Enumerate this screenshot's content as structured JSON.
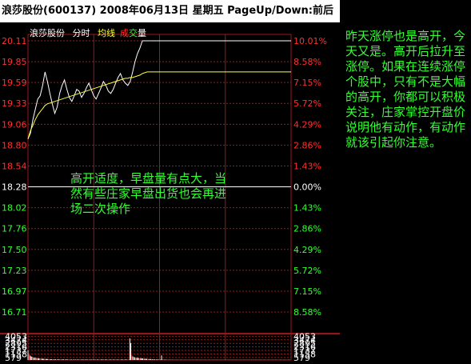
{
  "header": {
    "title": "浪莎股份(600137) 2008年06月13日 星期五 PageUp/Down:前后"
  },
  "legend": {
    "name": "浪莎股份",
    "tab_time": "分时",
    "tab_avg": "均线",
    "tab_cheng": "成",
    "tab_jiao": "交",
    "tab_liang": "量"
  },
  "colors": {
    "up": "#ff3030",
    "down": "#33ff33",
    "neutral": "#ffffff",
    "grid": "#a01818",
    "price_line": "#ffffff",
    "avg_line": "#ffff40",
    "legend_avg": "#ffff40",
    "legend_cheng": "#ff3030",
    "legend_jiao": "#33ff33"
  },
  "annotation": {
    "chart_note": "高开适度，早盘量有点大，当然有些庄家早盘出货也会再进场二次操作",
    "side_note": "昨天涨停也是高开，今天又是。高开后拉升至涨停。如果在连续涨停个股中，只有不是大幅的高开，你都可以积极关注，庄家掌控开盘价说明他有动作，有动作就该引起你注意。"
  },
  "chart_data": [
    {
      "type": "line",
      "title": "",
      "y_ticks": [
        "20.11",
        "19.85",
        "19.59",
        "19.33",
        "19.06",
        "18.80",
        "18.54",
        "18.28",
        "18.02",
        "17.76",
        "17.50",
        "17.23",
        "16.97",
        "16.71"
      ],
      "pct_ticks": [
        "10.01%",
        "8.58%",
        "7.15%",
        "5.72%",
        "4.29%",
        "2.86%",
        "1.43%",
        "0.00%",
        "1.43%",
        "2.86%",
        "4.29%",
        "5.72%",
        "7.15%",
        "8.58%"
      ],
      "prev_close": 18.28,
      "ylim": [
        16.45,
        20.11
      ],
      "x_count": 241,
      "series": [
        {
          "values": [
            18.88,
            18.95,
            19.12,
            19.25,
            19.38,
            19.42,
            19.55,
            19.72,
            19.6,
            19.45,
            19.32,
            19.2,
            19.28,
            19.45,
            19.55,
            19.62,
            19.5,
            19.4,
            19.35,
            19.42,
            19.5,
            19.48,
            19.4,
            19.45,
            19.52,
            19.58,
            19.5,
            19.42,
            19.38,
            19.45,
            19.52,
            19.6,
            19.55,
            19.48,
            19.45,
            19.5,
            19.58,
            19.65,
            19.7,
            19.62,
            19.58,
            19.55,
            19.6,
            19.72,
            19.85,
            19.95,
            20.02,
            20.11,
            20.11,
            20.11
          ]
        },
        {
          "values": [
            18.88,
            18.98,
            19.05,
            19.12,
            19.18,
            19.22,
            19.26,
            19.3,
            19.32,
            19.33,
            19.34,
            19.35,
            19.36,
            19.37,
            19.38,
            19.39,
            19.4,
            19.41,
            19.42,
            19.43,
            19.44,
            19.45,
            19.46,
            19.47,
            19.48,
            19.49,
            19.5,
            19.51,
            19.52,
            19.53,
            19.54,
            19.55,
            19.56,
            19.57,
            19.58,
            19.59,
            19.6,
            19.61,
            19.62,
            19.63,
            19.64,
            19.64,
            19.65,
            19.65,
            19.66,
            19.67,
            19.68,
            19.7,
            19.71,
            19.72
          ]
        }
      ]
    },
    {
      "type": "bar",
      "title": "",
      "y_ticks": [
        "4053",
        "3474",
        "2895",
        "2316",
        "1737",
        "1158",
        "579"
      ],
      "ylim": [
        0,
        4632
      ],
      "x_count": 241,
      "values": [
        1650,
        920,
        780,
        650,
        560,
        470,
        420,
        390,
        350,
        330,
        300,
        280,
        260,
        240,
        230,
        210,
        200,
        190,
        180,
        170,
        160,
        150,
        145,
        140,
        135,
        130,
        125,
        120,
        118,
        115,
        112,
        110,
        108,
        105,
        102,
        100,
        98,
        95,
        92,
        90,
        88,
        86,
        85,
        84,
        83,
        82,
        81,
        80,
        80,
        80,
        80,
        80,
        80,
        80,
        80,
        80,
        80,
        80,
        80,
        80,
        80,
        80,
        80,
        80,
        80,
        80,
        80,
        80,
        80,
        80,
        80,
        80,
        80,
        80,
        80,
        80,
        80,
        80,
        80,
        80,
        80,
        80,
        80,
        80,
        80,
        80,
        80,
        80,
        80,
        80,
        80,
        80,
        80,
        80,
        80,
        80,
        80,
        80,
        80,
        80,
        80,
        80,
        80,
        3700,
        2900,
        820,
        600,
        500,
        450,
        400,
        380,
        360,
        340,
        320,
        300,
        280,
        260,
        240,
        220,
        210,
        200,
        190,
        180,
        170,
        160,
        150,
        140,
        130,
        120,
        110,
        100,
        95,
        90,
        85,
        80,
        780,
        75,
        70,
        65,
        60,
        55,
        50,
        50,
        45,
        40,
        40,
        38,
        36,
        34,
        32,
        30,
        30,
        30,
        30,
        30,
        30,
        30,
        30,
        30,
        30,
        30,
        30,
        30,
        30,
        30,
        30,
        30,
        30,
        30,
        30,
        30,
        30,
        30,
        30,
        30,
        30,
        30,
        30,
        30,
        30,
        30,
        30,
        30,
        30,
        30,
        30,
        30,
        30,
        30,
        30,
        30,
        30,
        30,
        30,
        30,
        30,
        30,
        30,
        30,
        30,
        30,
        30,
        30,
        30,
        30,
        30,
        30,
        30,
        30,
        30,
        30,
        30,
        30,
        30,
        30,
        30,
        30,
        30,
        30,
        30,
        30,
        30,
        30,
        30,
        30,
        30,
        30,
        30,
        30,
        30,
        30,
        30,
        30,
        30,
        30,
        30,
        30,
        30,
        30,
        30,
        30,
        30,
        30,
        30,
        30,
        30,
        30,
        30,
        30,
        30,
        30,
        30,
        30,
        30,
        30,
        30,
        30,
        30,
        30,
        30,
        30,
        30,
        30,
        30,
        30,
        30
      ]
    }
  ]
}
